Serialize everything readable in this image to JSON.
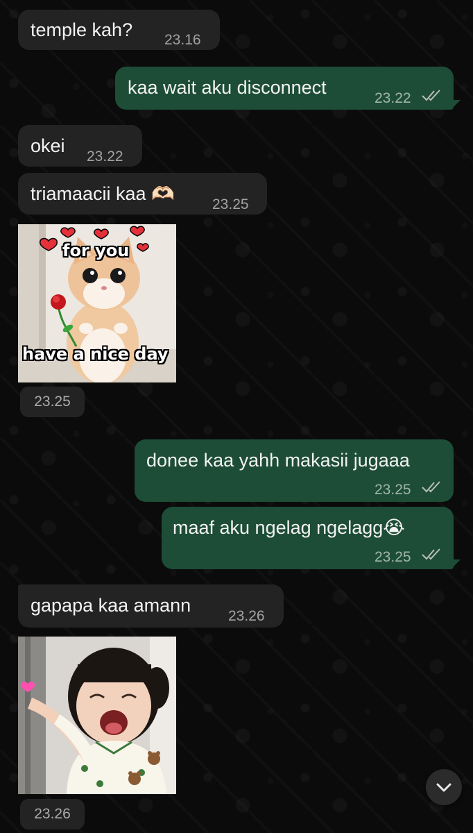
{
  "colors": {
    "background": "#0b0b0b",
    "incoming_bubble": "#232323",
    "outgoing_bubble": "#1d4d37",
    "read_ticks": "#bdbdbd",
    "text": "#f2f2f2"
  },
  "messages": [
    {
      "direction": "incoming",
      "text": "temple kah?",
      "time": "23.16"
    },
    {
      "direction": "outgoing",
      "text": "kaa wait aku disconnect",
      "time": "23.22",
      "status_icon": "double-check-icon"
    },
    {
      "direction": "incoming",
      "text": "okei",
      "time": "23.22"
    },
    {
      "direction": "incoming",
      "text": "triamaacii kaa 🫶🏻",
      "time": "23.25"
    },
    {
      "direction": "incoming",
      "type": "sticker",
      "sticker": {
        "top_text": "for you",
        "bottom_text": "have a nice day",
        "subject": "kitten-with-rose"
      },
      "time": "23.25"
    },
    {
      "direction": "outgoing",
      "text": "donee kaa yahh makasii jugaaa",
      "time": "23.25",
      "status_icon": "double-check-icon"
    },
    {
      "direction": "outgoing",
      "text": "maaf aku ngelag ngelagg😭",
      "time": "23.25",
      "status_icon": "double-check-icon"
    },
    {
      "direction": "incoming",
      "text": "gapapa kaa amann",
      "time": "23.26"
    },
    {
      "direction": "incoming",
      "type": "sticker",
      "sticker": {
        "subject": "little-girl-finger-heart"
      },
      "time": "23.26"
    }
  ],
  "scroll_button": {
    "icon": "chevron-down-icon"
  }
}
